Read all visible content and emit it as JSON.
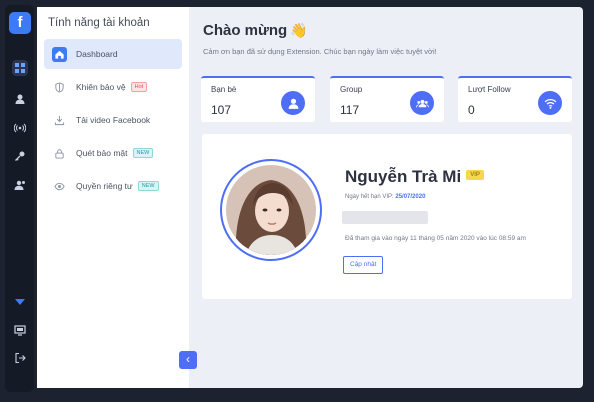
{
  "rail": {
    "logo": "f",
    "icons": [
      "dashboard-icon",
      "user-icon",
      "broadcast-icon",
      "key-icon",
      "users-icon",
      "funnel-icon",
      "monitor-icon",
      "logout-icon"
    ]
  },
  "sidebar": {
    "title": "Tính năng tài khoản",
    "items": [
      {
        "label": "Dashboard",
        "icon": "home-icon",
        "active": true
      },
      {
        "label": "Khiên bảo vệ",
        "icon": "shield-icon",
        "badge": "Hot"
      },
      {
        "label": "Tải video Facebook",
        "icon": "download-icon"
      },
      {
        "label": "Quét bảo mật",
        "icon": "lock-icon",
        "badge": "NEW"
      },
      {
        "label": "Quyền riêng tư",
        "icon": "eye-icon",
        "badge": "NEW"
      }
    ],
    "collapse": "‹"
  },
  "main": {
    "welcome": "Chào mừng",
    "wave": "👋",
    "subtitle": "Cảm ơn bạn đã sử dụng Extension. Chúc bạn ngày làm việc tuyệt vời!",
    "stats": [
      {
        "label": "Bạn bè",
        "value": "107",
        "icon": "user-icon"
      },
      {
        "label": "Group",
        "value": "117",
        "icon": "group-icon"
      },
      {
        "label": "Lượt Follow",
        "value": "0",
        "icon": "wifi-icon"
      }
    ],
    "profile": {
      "name": "Nguyễn Trà Mi",
      "vip": "VIP",
      "expiry_label": "Ngày hết hạn VIP:",
      "expiry_date": "25/07/2020",
      "joined": "Đã tham gia vào ngày 11 tháng 05 năm 2020 vào lúc 08:59 am",
      "update_label": "Cập nhật"
    }
  },
  "colors": {
    "accent": "#4d6ef5",
    "rail_bg": "#141a26",
    "main_bg": "#eceff6"
  }
}
